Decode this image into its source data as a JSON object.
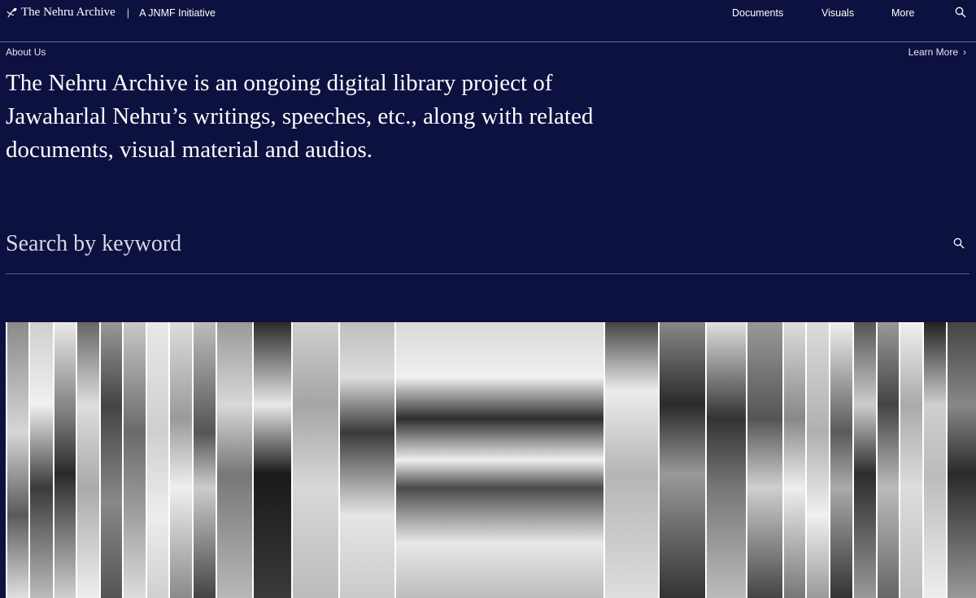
{
  "header": {
    "brand_name": "The Nehru Archive",
    "separator": "|",
    "brand_sub": "A JNMF Initiative",
    "nav": [
      "Documents",
      "Visuals",
      "More"
    ],
    "search_icon": "search-icon"
  },
  "about": {
    "label": "About Us",
    "learn_more": "Learn More",
    "chevron": "›"
  },
  "intro": {
    "text": "The Nehru Archive is an ongoing digital library project of Jawaharlal Nehru’s writings, speeches, etc., along with related documents, visual material and audios."
  },
  "search": {
    "placeholder": "Search by keyword",
    "icon": "search-icon"
  },
  "colors": {
    "background": "#0c1140",
    "text": "#ffffff"
  },
  "collage": {
    "image_type": "black-and-white historical photograph strips"
  }
}
